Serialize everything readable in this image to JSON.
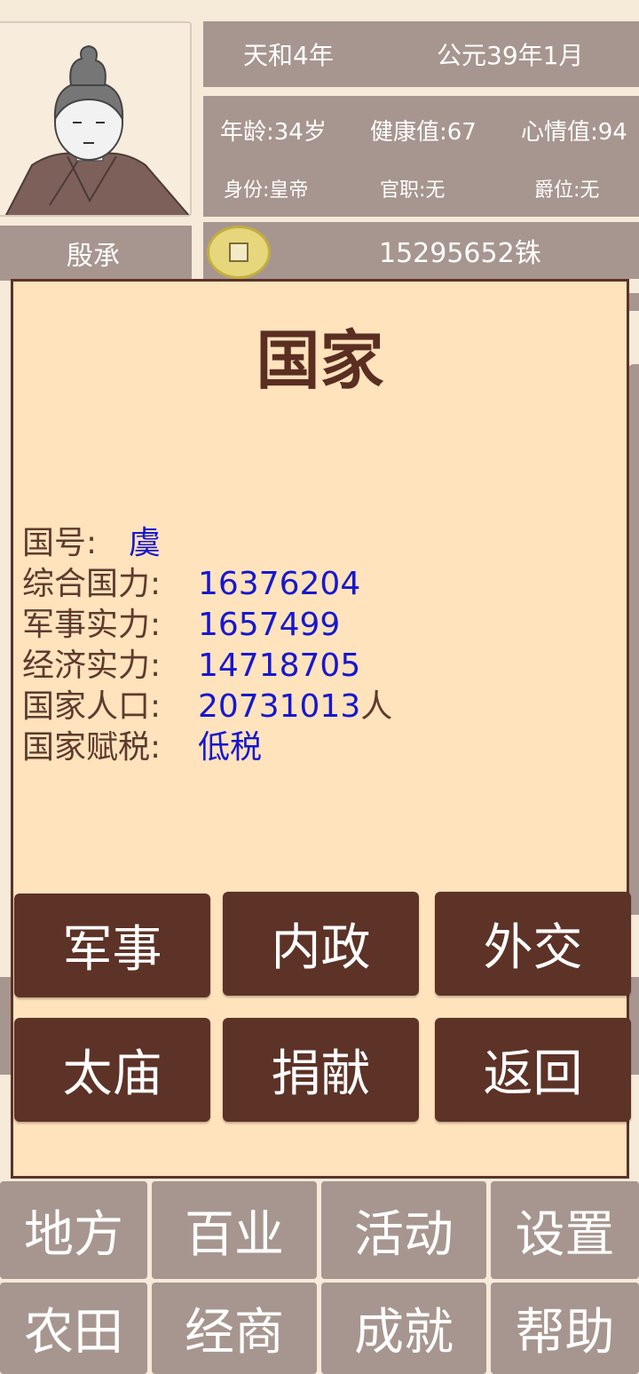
{
  "header": {
    "reign_date": "天和4年",
    "gregorian_date": "公元39年1月",
    "player_name": "殷承",
    "stats": {
      "age": "年龄:34岁",
      "health": "健康值:67",
      "mood": "心情值:94",
      "identity": "身份:皇帝",
      "office": "官职:无",
      "title": "爵位:无"
    },
    "money": "15295652铢",
    "icons": {
      "portrait": "emperor-portrait",
      "coin": "coin-icon"
    }
  },
  "modal": {
    "title": "国家",
    "info": [
      {
        "label": "国号:",
        "value": "虞",
        "unit": ""
      },
      {
        "label": "综合国力:",
        "value": "16376204",
        "unit": ""
      },
      {
        "label": "军事实力:",
        "value": "1657499",
        "unit": ""
      },
      {
        "label": "经济实力:",
        "value": "14718705",
        "unit": ""
      },
      {
        "label": "国家人口:",
        "value": "20731013",
        "unit": "人"
      },
      {
        "label": "国家赋税:",
        "value": "低税",
        "unit": ""
      }
    ],
    "buttons": [
      "军事",
      "内政",
      "外交",
      "太庙",
      "捐献",
      "返回"
    ]
  },
  "nav": {
    "row1": [
      "地方",
      "百业",
      "活动",
      "设置"
    ],
    "row2": [
      "农田",
      "经商",
      "成就",
      "帮助"
    ]
  },
  "colors": {
    "panel": "#a7968f",
    "modal_bg": "#ffe3bc",
    "modal_border": "#5d3227",
    "button": "#5d3227",
    "value_blue": "#1717cf"
  }
}
